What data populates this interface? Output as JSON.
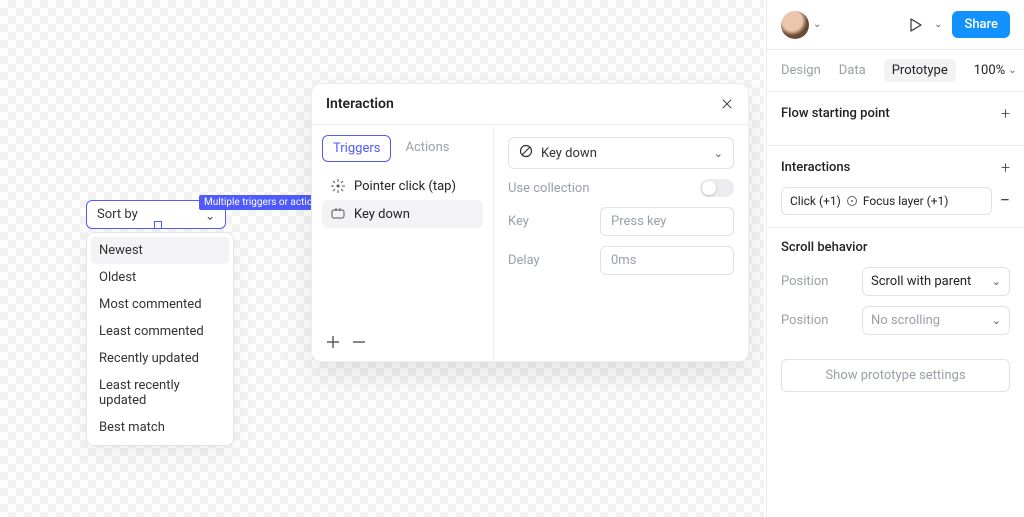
{
  "canvas": {
    "sortby_label": "Sort by",
    "hint": "Multiple triggers or actions",
    "dropdown_items": [
      "Newest",
      "Oldest",
      "Most commented",
      "Least commented",
      "Recently updated",
      "Least recently updated",
      "Best match"
    ]
  },
  "interaction": {
    "title": "Interaction",
    "tabs": {
      "triggers": "Triggers",
      "actions": "Actions"
    },
    "triggers": [
      {
        "label": "Pointer click (tap)",
        "icon": "pointer-click-icon"
      },
      {
        "label": "Key down",
        "icon": "key-press-icon"
      }
    ],
    "form": {
      "trigger_type": "Key down",
      "use_collection_label": "Use collection",
      "key_label": "Key",
      "key_placeholder": "Press key",
      "delay_label": "Delay",
      "delay_value": "0ms"
    }
  },
  "sidebar": {
    "share": "Share",
    "tabs": {
      "design": "Design",
      "data": "Data",
      "prototype": "Prototype"
    },
    "zoom": "100%",
    "flow_label": "Flow starting point",
    "interactions_label": "Interactions",
    "interaction_pill": {
      "left": "Click (+1)",
      "right": "Focus layer (+1)"
    },
    "scroll_behavior_label": "Scroll behavior",
    "position_label": "Position",
    "position_1": "Scroll with parent",
    "position_2": "No scrolling",
    "proto_settings": "Show prototype settings"
  }
}
